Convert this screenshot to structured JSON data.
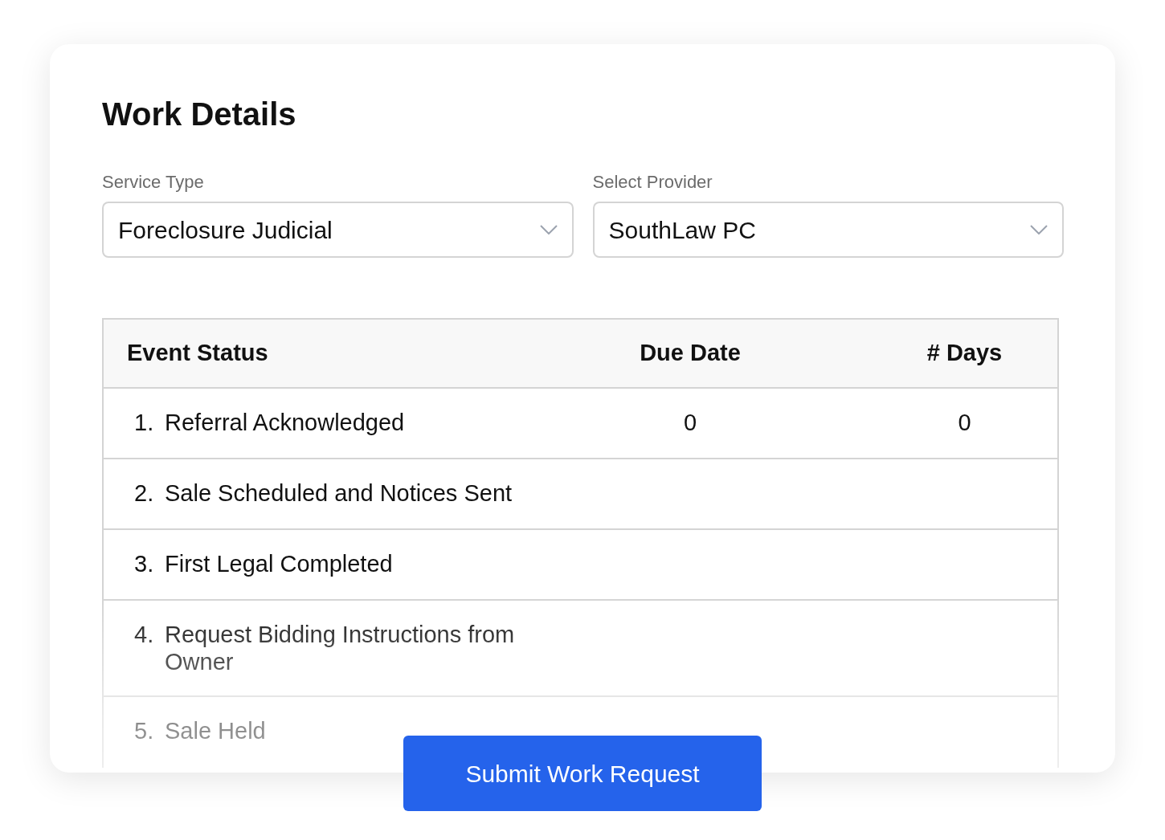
{
  "title": "Work Details",
  "fields": [
    {
      "label": "Service Type",
      "value": "Foreclosure Judicial"
    },
    {
      "label": "Select Provider",
      "value": "SouthLaw PC"
    }
  ],
  "table": {
    "columns": [
      "Event Status",
      "Due Date",
      "# Days"
    ],
    "rows": [
      {
        "number": "1.",
        "event": "Referral Acknowledged",
        "due_date": "0",
        "days": "0"
      },
      {
        "number": "2.",
        "event": "Sale Scheduled and Notices Sent"
      },
      {
        "number": "3.",
        "event": "First Legal Completed"
      },
      {
        "number": "4.",
        "event": "Request Bidding Instructions from Owner"
      },
      {
        "number": "5.",
        "event": "Sale Held"
      }
    ]
  },
  "submit_button": "Submit Work Request"
}
